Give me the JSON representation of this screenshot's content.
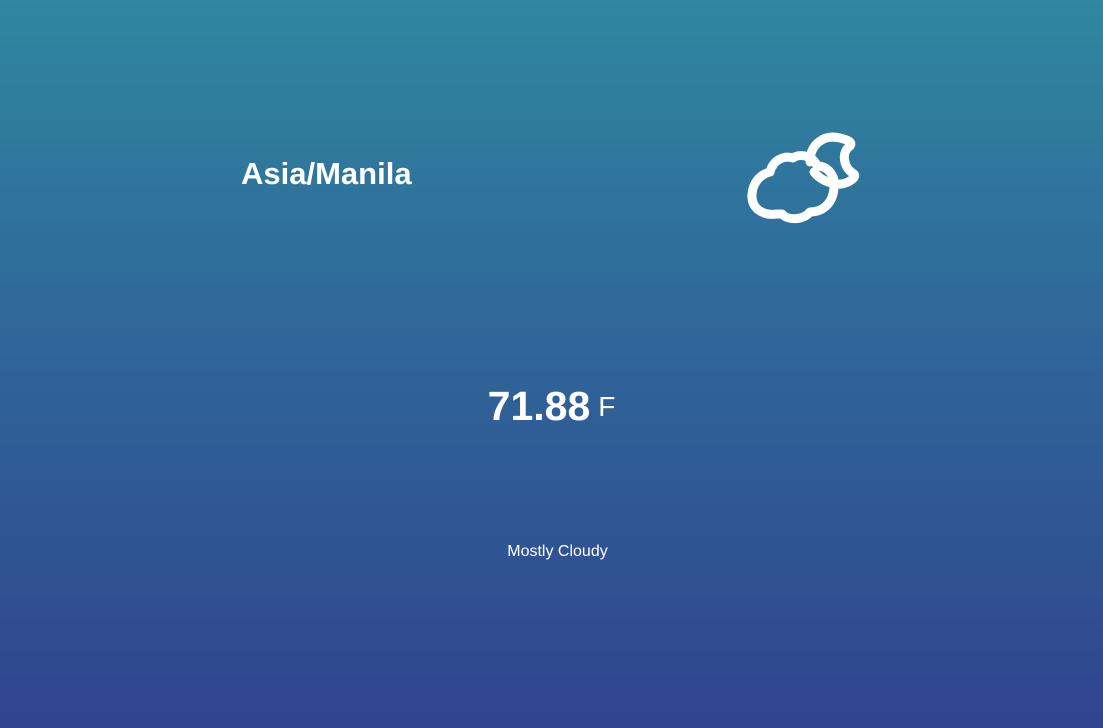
{
  "weather": {
    "timezone": "Asia/Manila",
    "icon": "partly-cloudy-night-icon",
    "temperature": "71.88",
    "unit": "F",
    "summary": "Mostly Cloudy"
  },
  "colors": {
    "background_top": "#2f87a0",
    "background_bottom": "#30448f",
    "text": "#ffffff"
  }
}
